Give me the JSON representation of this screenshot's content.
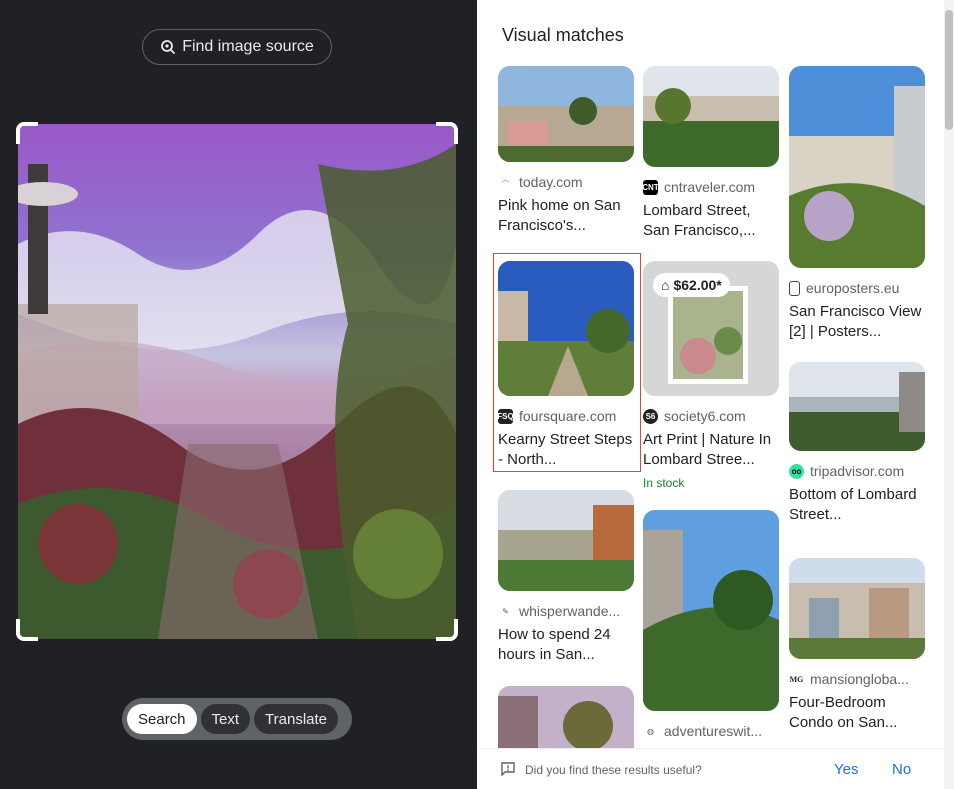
{
  "left": {
    "find_source_label": "Find image source",
    "modes": [
      "Search",
      "Text",
      "Translate"
    ],
    "active_mode": "Search"
  },
  "right": {
    "title": "Visual matches",
    "results": [
      {
        "source": "today.com",
        "title": "Pink home on San Francisco's...",
        "favicon": "rainbow-icon"
      },
      {
        "source": "cntraveler.com",
        "title": "Lombard Street, San Francisco,...",
        "favicon": "cnt-icon"
      },
      {
        "source": "europosters.eu",
        "title": "San Francisco View [2] | Posters...",
        "favicon": "phone-icon"
      },
      {
        "source": "foursquare.com",
        "title": "Kearny Street Steps - North...",
        "favicon": "foursquare-icon"
      },
      {
        "source": "society6.com",
        "title": "Art Print | Nature In Lombard Stree...",
        "favicon": "s6-icon",
        "price": "$62.00*",
        "stock": "In stock"
      },
      {
        "source": "tripadvisor.com",
        "title": "Bottom of Lombard Street...",
        "favicon": "tripadvisor-icon"
      },
      {
        "source": "whisperwande...",
        "title": "How to spend 24 hours in San...",
        "favicon": "feather-icon"
      },
      {
        "source": "adventureswit...",
        "title": "",
        "favicon": "globe-icon"
      },
      {
        "source": "mansiongloba...",
        "title": "Four-Bedroom Condo on San...",
        "favicon": "mg-icon"
      }
    ],
    "feedback": {
      "question": "Did you find these results useful?",
      "yes": "Yes",
      "no": "No"
    }
  },
  "colors": {
    "dark_bg": "#202124",
    "link_blue": "#1a73e8",
    "highlight_red": "#ea4335",
    "stock_green": "#188038"
  }
}
